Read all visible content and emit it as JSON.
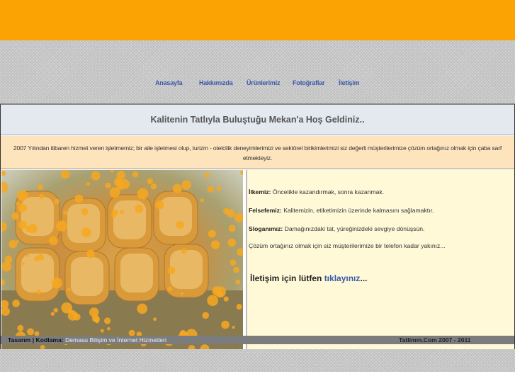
{
  "nav": [
    "Anasayfa",
    "Hakkımızda",
    "Ürünlerimiz",
    "Fotoğraflar",
    "İletişim"
  ],
  "welcome": "Kalitenin Tatlıyla Buluştuğu Mekan'a Hoş Geldiniz..",
  "intro": "2007 Yılından itibaren hizmet veren işletmemiz; bir aile işletmesi olup, turizm - otelcilik deneyimlerimizi ve sektörel birikimlerimizi siz değerli müşterilerimize çözüm ortağınız olmak için çaba sarf etmekteyiz.",
  "items": [
    {
      "label": "İlkemiz:",
      "text": "Öncelikle kazandırmak, sonra kazanmak."
    },
    {
      "label": "Felsefemiz:",
      "text": "Kalitemizin, etiketimizin üzerinde kalmasını sağlamaktır."
    },
    {
      "label": "Sloganımız:",
      "text": "Damağınızdaki tat, yüreğinizdeki sevgiye dönüşsün."
    }
  ],
  "closing": "Çözüm ortağınız olmak için siz müşterilerimize bir telefon kadar yakınız...",
  "contact": {
    "prefix": "İletişim için lütfen ",
    "link": "tıklayınız",
    "suffix": "..."
  },
  "footer": {
    "label": "Tasarım | Kodlama:",
    "company": "Demasu Bilişim ve İnternet Hizmetleri",
    "copyright": "Tatlimm.Com 2007 - 2011"
  },
  "colors": {
    "top": "#fba302",
    "link": "#3a5aa8"
  }
}
